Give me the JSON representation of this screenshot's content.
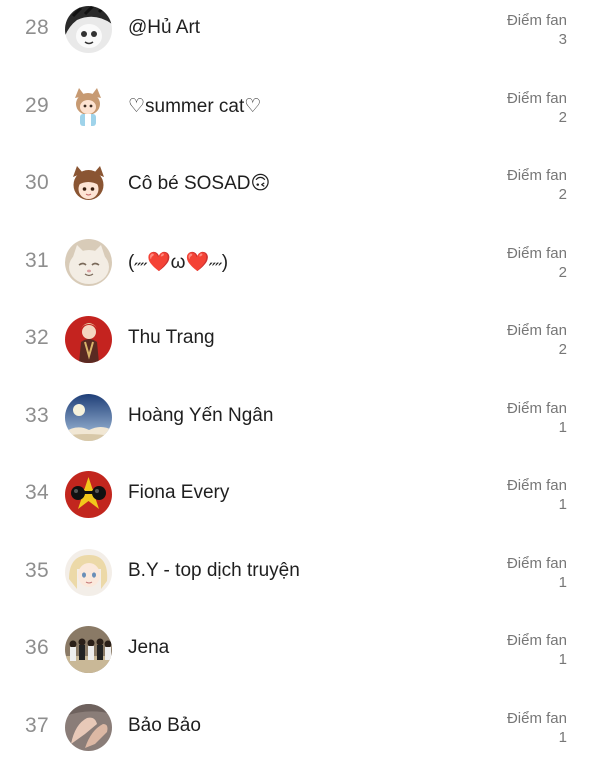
{
  "score_label": "Điểm fan",
  "rows": [
    {
      "rank": "28",
      "name": "@Hủ Art",
      "score": "3",
      "avatar": "manga-face-avatar"
    },
    {
      "rank": "29",
      "name": "♡summer cat♡",
      "score": "2",
      "avatar": "anime-cat-girl-avatar"
    },
    {
      "rank": "30",
      "name": "Cô bé SOSAD🙃",
      "score": "2",
      "avatar": "brown-hair-girl-avatar"
    },
    {
      "rank": "31",
      "name": "(˶˶❤️ω❤️˶˶)",
      "score": "2",
      "avatar": "white-cat-avatar"
    },
    {
      "rank": "32",
      "name": "Thu Trang",
      "score": "2",
      "avatar": "red-background-character-avatar"
    },
    {
      "rank": "33",
      "name": "Hoàng Yến Ngân",
      "score": "1",
      "avatar": "moon-sky-avatar"
    },
    {
      "rank": "34",
      "name": "Fiona Every",
      "score": "1",
      "avatar": "sunglasses-star-avatar"
    },
    {
      "rank": "35",
      "name": "B.Y - top dịch truyện",
      "score": "1",
      "avatar": "blonde-anime-girl-avatar"
    },
    {
      "rank": "36",
      "name": "Jena",
      "score": "1",
      "avatar": "group-photo-avatar"
    },
    {
      "rank": "37",
      "name": "Bảo Bảo",
      "score": "1",
      "avatar": "hands-photo-avatar"
    }
  ]
}
